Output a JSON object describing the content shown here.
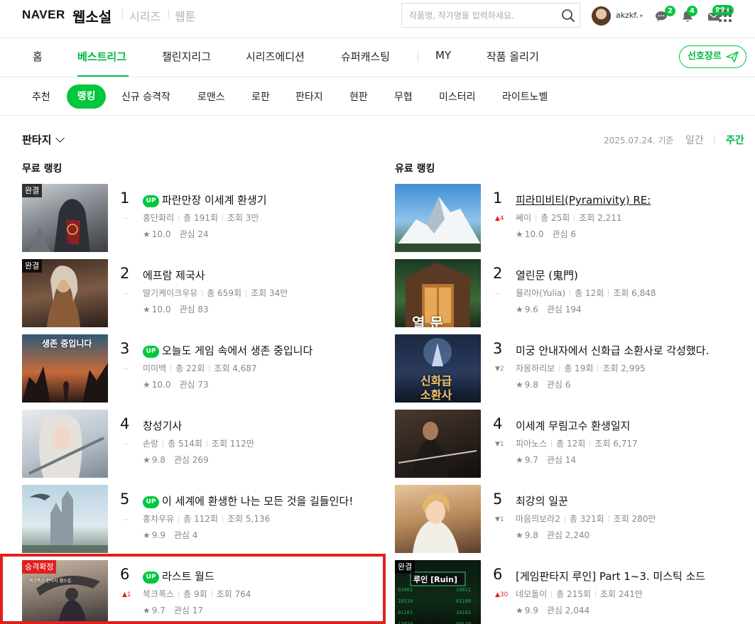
{
  "header": {
    "naver_logo": "NAVER",
    "service_name": "웹소설",
    "links": [
      "시리즈",
      "웹툰"
    ],
    "search_placeholder": "작품명, 작가명을 입력하세요.",
    "username": "akzkf.",
    "badges": {
      "comments": "2",
      "notifications": "4",
      "messages": "99+"
    }
  },
  "main_nav": {
    "items": [
      "홈",
      "베스트리그",
      "챌린지리그",
      "시리즈에디션",
      "슈퍼캐스팅",
      "MY",
      "작품 올리기"
    ],
    "active": "베스트리그",
    "favorite_genre_label": "선호장르"
  },
  "sub_nav": {
    "items": [
      "추천",
      "랭킹",
      "신규 승격작",
      "로맨스",
      "로판",
      "판타지",
      "현판",
      "무협",
      "미스터리",
      "라이트노벨"
    ],
    "active": "랭킹"
  },
  "controls": {
    "genre": "판타지",
    "date_label": "2025.07.24. 기준",
    "period_daily": "일간",
    "period_weekly": "주간",
    "period_active": "주간"
  },
  "free_ranking": {
    "title": "무료 랭킹",
    "items": [
      {
        "rank": "1",
        "change": "—",
        "change_dir": "none",
        "up": true,
        "tag": "완결",
        "title": "파란만장 이세계 환생기",
        "author": "홍단화리",
        "episodes": "총 191회",
        "views": "조회 3만",
        "score": "10.0",
        "interest": "관심 24"
      },
      {
        "rank": "2",
        "change": "—",
        "change_dir": "none",
        "up": false,
        "tag": "완결",
        "title": "에프람 제국사",
        "author": "딸기케이크우유",
        "episodes": "총 659회",
        "views": "조회 34만",
        "score": "10.0",
        "interest": "관심 83"
      },
      {
        "rank": "3",
        "change": "—",
        "change_dir": "none",
        "up": true,
        "tag": "",
        "title": "오늘도 게임 속에서 생존 중입니다",
        "author": "미미백",
        "episodes": "총 22회",
        "views": "조회 4,687",
        "score": "10.0",
        "interest": "관심 73"
      },
      {
        "rank": "4",
        "change": "—",
        "change_dir": "none",
        "up": false,
        "tag": "",
        "title": "창성기사",
        "author": "손랑",
        "episodes": "총 514회",
        "views": "조회 112만",
        "score": "9.8",
        "interest": "관심 269"
      },
      {
        "rank": "5",
        "change": "—",
        "change_dir": "none",
        "up": true,
        "tag": "",
        "title": "이 세계에 환생한 나는 모든 것을 길들인다!",
        "author": "홍차우유",
        "episodes": "총 112회",
        "views": "조회 5,136",
        "score": "9.9",
        "interest": "관심 4"
      },
      {
        "rank": "6",
        "change": "▲1",
        "change_dir": "up",
        "up": true,
        "tag": "승격확정",
        "title": "라스트 월드",
        "author": "북크폭스",
        "episodes": "총 9회",
        "views": "조회 764",
        "score": "9.7",
        "interest": "관심 17"
      }
    ]
  },
  "paid_ranking": {
    "title": "유료 랭킹",
    "items": [
      {
        "rank": "1",
        "change": "▲4",
        "change_dir": "up",
        "up": false,
        "tag": "",
        "title": "피라미비티(Pyramivity) RE:",
        "author": "쎄이",
        "episodes": "총 25회",
        "views": "조회 2,211",
        "score": "10.0",
        "interest": "관심 6"
      },
      {
        "rank": "2",
        "change": "—",
        "change_dir": "none",
        "up": false,
        "tag": "",
        "title": "열린문 (鬼門)",
        "author": "율리아(Yulia)",
        "episodes": "총 12회",
        "views": "조회 6,848",
        "score": "9.6",
        "interest": "관심 194"
      },
      {
        "rank": "3",
        "change": "▼2",
        "change_dir": "down",
        "up": false,
        "tag": "",
        "title": "미궁 안내자에서 신화급 소환사로 각성했다.",
        "author": "자몽하리보",
        "episodes": "총 19회",
        "views": "조회 2,995",
        "score": "9.8",
        "interest": "관심 6"
      },
      {
        "rank": "4",
        "change": "▼1",
        "change_dir": "down",
        "up": false,
        "tag": "",
        "title": "이세계 무림고수 환생일지",
        "author": "피아노스",
        "episodes": "총 12회",
        "views": "조회 6,717",
        "score": "9.7",
        "interest": "관심 14"
      },
      {
        "rank": "5",
        "change": "▼1",
        "change_dir": "down",
        "up": false,
        "tag": "",
        "title": "최강의 일꾼",
        "author": "마음의보라2",
        "episodes": "총 321회",
        "views": "조회 280만",
        "score": "9.8",
        "interest": "관심 2,240"
      },
      {
        "rank": "6",
        "change": "▲30",
        "change_dir": "up",
        "up": false,
        "tag": "완결",
        "title": "[게임판타지 루인] Part 1~3. 미스틱 소드",
        "author": "네모돌이",
        "episodes": "총 215회",
        "views": "조회 241만",
        "score": "9.9",
        "interest": "관심 2,044"
      }
    ]
  },
  "thumbnail_text": {
    "free_3": "생존 중입니다",
    "paid_2": "열 문",
    "paid_3_line1": "신화급",
    "paid_3_line2": "소환사",
    "paid_6": "루인 [Ruin]",
    "free_6_small": "북크폭스 판타지 웹소설"
  }
}
